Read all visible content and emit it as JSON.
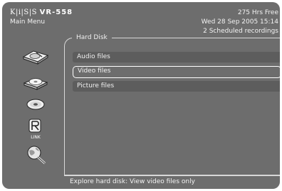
{
  "brand": {
    "logo_kiss": "K|i|S|S",
    "logo_model": "VR-558"
  },
  "header": {
    "menu_title": "Main Menu",
    "hrs_free": "275 Hrs Free",
    "datetime": "Wed 28 Sep 2005 15:14",
    "scheduled": "2 Scheduled recordings"
  },
  "section": {
    "legend": "Hard Disk"
  },
  "menu": {
    "items": [
      {
        "label": "Audio files"
      },
      {
        "label": "Video files"
      },
      {
        "label": "Picture files"
      }
    ],
    "selected": "Video files"
  },
  "sidebar": {
    "icons": [
      "hard-disk-icon",
      "dvd-drive-icon",
      "cd-disc-icon",
      "kiss-link-icon",
      "internet-globe-icon"
    ],
    "link_label": "LINK"
  },
  "help_text": "Explore hard disk: View video files only",
  "colors": {
    "background": "#6d6d6d",
    "item_background": "#5d5d5d",
    "text": "#f2f2f2",
    "border": "#d8d8d8"
  }
}
